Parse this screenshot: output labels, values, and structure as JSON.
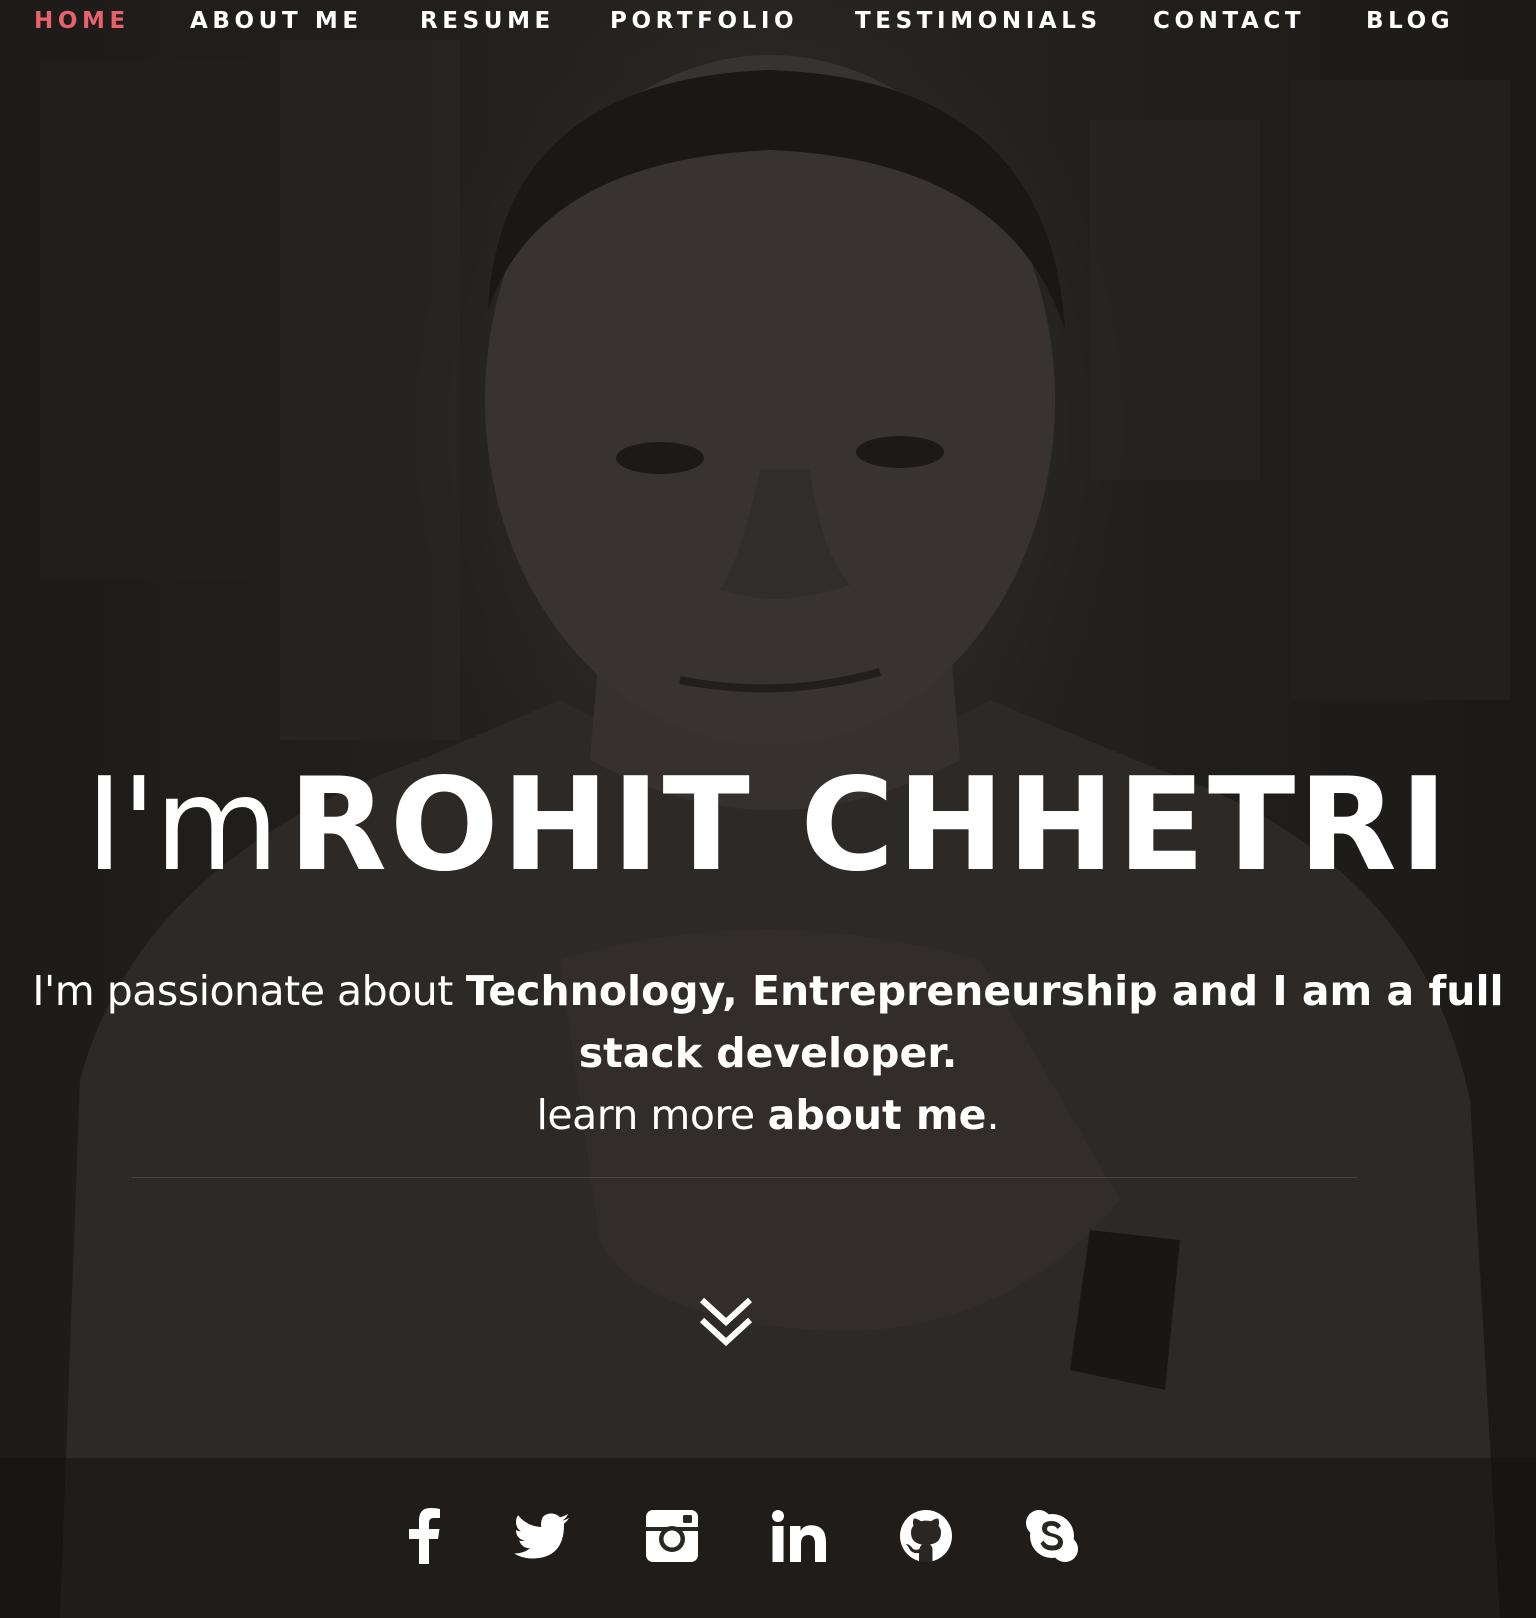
{
  "nav": {
    "items": [
      {
        "label": "HOME",
        "active": true
      },
      {
        "label": "ABOUT ME",
        "active": false
      },
      {
        "label": "RESUME",
        "active": false
      },
      {
        "label": "PORTFOLIO",
        "active": false
      },
      {
        "label": "TESTIMONIALS",
        "active": false
      },
      {
        "label": "CONTACT",
        "active": false
      },
      {
        "label": "BLOG",
        "active": false
      }
    ],
    "active_color": "#e8626b"
  },
  "hero": {
    "greeting": "I'm",
    "name": "ROHIT CHHETRI",
    "intro_prefix": "I'm passionate about",
    "intro_highlight": "Technology, Entrepreneurship and I am a full stack developer.",
    "learn_prefix": "learn more",
    "learn_link": "about me",
    "learn_suffix": "."
  },
  "scroll_down": {
    "icon": "double-chevron-down-icon"
  },
  "social": [
    {
      "icon": "facebook-icon"
    },
    {
      "icon": "twitter-icon"
    },
    {
      "icon": "instagram-icon"
    },
    {
      "icon": "linkedin-icon"
    },
    {
      "icon": "github-icon"
    },
    {
      "icon": "skype-icon"
    }
  ]
}
